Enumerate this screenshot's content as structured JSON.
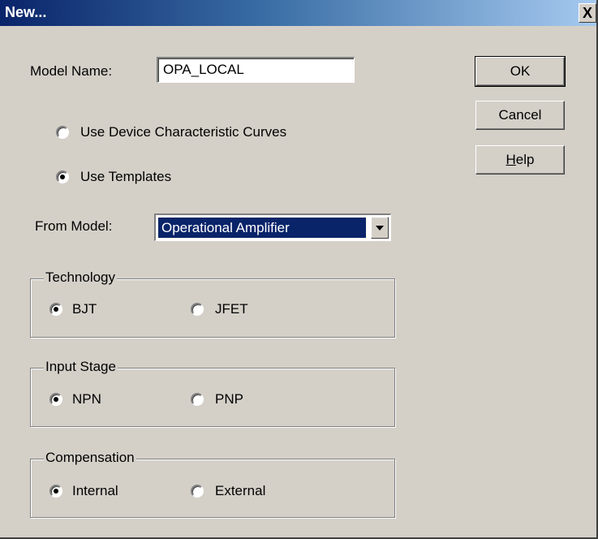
{
  "window": {
    "title": "New...",
    "close_glyph": "X"
  },
  "model_name": {
    "label": "Model Name:",
    "value": "OPA_LOCAL"
  },
  "source": {
    "options": [
      {
        "label": "Use Device Characteristic Curves",
        "checked": false
      },
      {
        "label": "Use Templates",
        "checked": true
      }
    ]
  },
  "from_model": {
    "label": "From Model:",
    "selected": "Operational Amplifier"
  },
  "groups": {
    "technology": {
      "title": "Technology",
      "options": [
        {
          "label": "BJT",
          "checked": true
        },
        {
          "label": "JFET",
          "checked": false
        }
      ]
    },
    "input_stage": {
      "title": "Input Stage",
      "options": [
        {
          "label": "NPN",
          "checked": true
        },
        {
          "label": "PNP",
          "checked": false
        }
      ]
    },
    "compensation": {
      "title": "Compensation",
      "options": [
        {
          "label": "Internal",
          "checked": true
        },
        {
          "label": "External",
          "checked": false
        }
      ]
    }
  },
  "buttons": {
    "ok": "OK",
    "cancel": "Cancel",
    "help_first": "H",
    "help_rest": "elp"
  }
}
